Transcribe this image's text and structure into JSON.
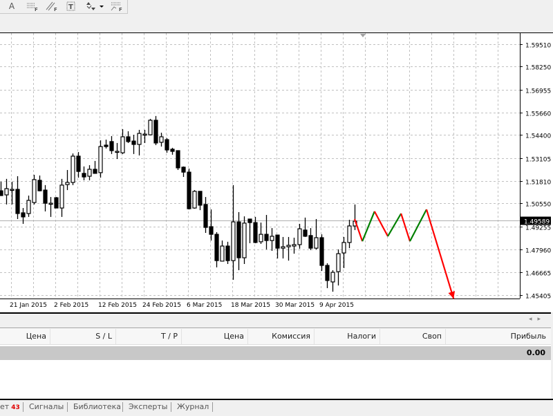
{
  "toolbar": {
    "items": [
      {
        "icon": "text-icon",
        "label": "A"
      },
      {
        "icon": "fibo-lines-icon",
        "label": "F"
      },
      {
        "icon": "fibo-channel-icon",
        "label": "F"
      },
      {
        "icon": "text-label-icon",
        "label": "T"
      },
      {
        "icon": "arrows-dropdown-icon",
        "label": ""
      },
      {
        "icon": "fibo-expansion-icon",
        "label": "F"
      }
    ]
  },
  "chart": {
    "current_price": "1.49589",
    "price_labels": [
      "1.59510",
      "1.58250",
      "1.56955",
      "1.55660",
      "1.54400",
      "1.53105",
      "1.51810",
      "1.50550",
      "1.49255",
      "1.47960",
      "1.46665",
      "1.45405"
    ],
    "date_labels": [
      "21 Jan 2015",
      "2 Feb 2015",
      "12 Feb 2015",
      "24 Feb 2015",
      "6 Mar 2015",
      "18 Mar 2015",
      "30 Mar 2015",
      "9 Apr 2015"
    ],
    "colors": {
      "up_segment": "#008000",
      "down_segment": "#ff0000",
      "grid": "#c0c0c0"
    }
  },
  "chart_data": {
    "type": "candlestick",
    "columns": [
      "open",
      "high",
      "low",
      "close"
    ],
    "candles": [
      [
        1.5126,
        1.5177,
        1.5099,
        1.5099
      ],
      [
        1.5103,
        1.5193,
        1.5049,
        1.5138
      ],
      [
        1.5134,
        1.5177,
        1.5049,
        1.5134
      ],
      [
        1.5134,
        1.5208,
        1.4967,
        1.4998
      ],
      [
        1.5002,
        1.5029,
        1.494,
        1.4979
      ],
      [
        1.4998,
        1.5099,
        1.4979,
        1.5072
      ],
      [
        1.506,
        1.5216,
        1.5049,
        1.5189
      ],
      [
        1.5185,
        1.5212,
        1.5123,
        1.5126
      ],
      [
        1.513,
        1.5158,
        1.501,
        1.5056
      ],
      [
        1.5056,
        1.5091,
        1.4979,
        1.5056
      ],
      [
        1.5087,
        1.5091,
        1.5029,
        1.5029
      ],
      [
        1.5029,
        1.5193,
        1.4979,
        1.5158
      ],
      [
        1.5161,
        1.5243,
        1.513,
        1.5173
      ],
      [
        1.5173,
        1.5336,
        1.5158,
        1.5321
      ],
      [
        1.5321,
        1.5344,
        1.52,
        1.5235
      ],
      [
        1.5224,
        1.5263,
        1.5185,
        1.5204
      ],
      [
        1.5208,
        1.527,
        1.5185,
        1.5247
      ],
      [
        1.5247,
        1.5294,
        1.5224,
        1.5224
      ],
      [
        1.5228,
        1.541,
        1.52,
        1.5375
      ],
      [
        1.5383,
        1.5414,
        1.5364,
        1.5375
      ],
      [
        1.5403,
        1.5434,
        1.5333,
        1.5352
      ],
      [
        1.5348,
        1.5395,
        1.5305,
        1.5348
      ],
      [
        1.534,
        1.5473,
        1.5333,
        1.543
      ],
      [
        1.543,
        1.5461,
        1.5395,
        1.5403
      ],
      [
        1.5406,
        1.5441,
        1.5333,
        1.5387
      ],
      [
        1.5387,
        1.5469,
        1.5325,
        1.5449
      ],
      [
        1.5445,
        1.5469,
        1.5395,
        1.5445
      ],
      [
        1.5441,
        1.5531,
        1.5438,
        1.5523
      ],
      [
        1.5523,
        1.5547,
        1.5383,
        1.5395
      ],
      [
        1.5399,
        1.5453,
        1.5375,
        1.543
      ],
      [
        1.5414,
        1.5422,
        1.534,
        1.5356
      ],
      [
        1.536,
        1.5368,
        1.5329,
        1.5348
      ],
      [
        1.5352,
        1.5352,
        1.5243,
        1.5255
      ],
      [
        1.5259,
        1.5263,
        1.5204,
        1.5231
      ],
      [
        1.5231,
        1.5251,
        1.5021,
        1.5025
      ],
      [
        1.5029,
        1.513,
        1.5025,
        1.5123
      ],
      [
        1.5123,
        1.5123,
        1.5017,
        1.5045
      ],
      [
        1.5049,
        1.5091,
        1.4889,
        1.492
      ],
      [
        1.4924,
        1.5021,
        1.4846,
        1.4881
      ],
      [
        1.4881,
        1.4893,
        1.4695,
        1.4733
      ],
      [
        1.473,
        1.4846,
        1.473,
        1.4815
      ],
      [
        1.4815,
        1.4839,
        1.4714,
        1.4733
      ],
      [
        1.4733,
        1.5158,
        1.4625,
        1.4951
      ],
      [
        1.4951,
        1.5006,
        1.4679,
        1.4749
      ],
      [
        1.4749,
        1.4982,
        1.4714,
        1.4944
      ],
      [
        1.4967,
        1.4967,
        1.4831,
        1.4947
      ],
      [
        1.4947,
        1.4979,
        1.4831,
        1.4835
      ],
      [
        1.4839,
        1.4947,
        1.4827,
        1.4881
      ],
      [
        1.4881,
        1.499,
        1.4796,
        1.4846
      ],
      [
        1.4846,
        1.4916,
        1.4788,
        1.487
      ],
      [
        1.4877,
        1.4877,
        1.4745,
        1.4803
      ],
      [
        1.4803,
        1.4866,
        1.4745,
        1.4811
      ],
      [
        1.4811,
        1.4866,
        1.4733,
        1.4819
      ],
      [
        1.4815,
        1.4862,
        1.4772,
        1.4823
      ],
      [
        1.4823,
        1.494,
        1.48,
        1.4912
      ],
      [
        1.4905,
        1.4975,
        1.4866,
        1.487
      ],
      [
        1.4874,
        1.4916,
        1.4792,
        1.4803
      ],
      [
        1.4803,
        1.4967,
        1.4796,
        1.4862
      ],
      [
        1.4862,
        1.4881,
        1.4675,
        1.4706
      ],
      [
        1.4706,
        1.4718,
        1.4578,
        1.4621
      ],
      [
        1.4613,
        1.4679,
        1.4558,
        1.4667
      ],
      [
        1.4671,
        1.4796,
        1.4593,
        1.4772
      ],
      [
        1.4776,
        1.4866,
        1.4691,
        1.4835
      ],
      [
        1.4835,
        1.4963,
        1.4803,
        1.4928
      ],
      [
        1.4928,
        1.5049,
        1.4905,
        1.4955
      ]
    ],
    "projection": {
      "bar_index": [
        65,
        66.4,
        68.6,
        71,
        73.4,
        75,
        78,
        82.9
      ],
      "price": [
        1.4967,
        1.4842,
        1.501,
        1.487,
        1.4998,
        1.4842,
        1.5021,
        1.4519
      ]
    },
    "ylim": [
      1.454,
      1.5951
    ]
  },
  "table": {
    "headers": [
      "Цена",
      "S / L",
      "T / P",
      "Цена",
      "Комиссия",
      "Налоги",
      "Своп",
      "Прибыль"
    ],
    "total_profit": "0.00"
  },
  "tabs": [
    {
      "label": "ет",
      "badge": "43"
    },
    {
      "label": "Сигналы"
    },
    {
      "label": "Библиотека"
    },
    {
      "label": "Эксперты"
    },
    {
      "label": "Журнал"
    }
  ],
  "scroll": {
    "left": "◂",
    "right": "▸"
  }
}
